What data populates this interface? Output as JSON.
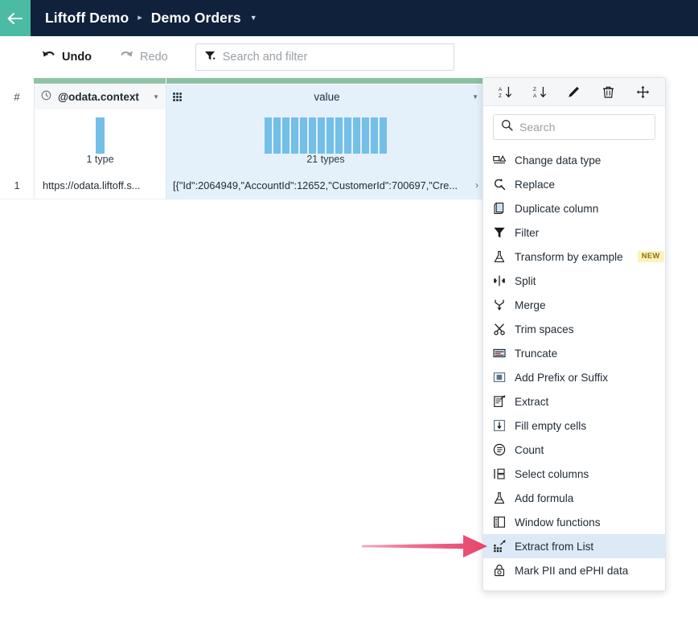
{
  "appbar": {
    "back_icon": "arrow-left-icon",
    "breadcrumb": {
      "root": "Liftoff Demo",
      "separator": "▸",
      "current": "Demo Orders",
      "caret": "▼"
    },
    "bg_color": "#10213c",
    "back_color": "#4cbba4"
  },
  "toolbar": {
    "undo_label": "Undo",
    "redo_label": "Redo",
    "search_placeholder": "Search and filter",
    "filter_icon": "filter-icon"
  },
  "grid": {
    "row_number_header": "#",
    "columns": [
      {
        "name": "@odata.context",
        "type_icon": "clock-icon",
        "caret": "▼",
        "types_label": "1 type",
        "histogram": [
          100
        ],
        "selected": false
      },
      {
        "name": "value",
        "drag_icon": "drag-dots-icon",
        "caret": "▼",
        "types_label": "21 types",
        "histogram": [
          100,
          100,
          100,
          100,
          100,
          100,
          100,
          100,
          100,
          100,
          100,
          100,
          100,
          100
        ],
        "selected": true
      }
    ],
    "rows": [
      {
        "number": "1",
        "context": "https://odata.liftoff.s...",
        "value": "[{\"Id\":2064949,\"AccountId\":12652,\"CustomerId\":700697,\"Cre...",
        "expand_icon": "chevron-right-icon"
      }
    ],
    "quality_bar_color": "#90c3a6",
    "selected_column_color": "#e4f1fb",
    "histogram_bar_color": "#73bfe8"
  },
  "context_menu": {
    "toolbar_icons": [
      {
        "name": "sort-ascending-icon",
        "label": "Sort ascending"
      },
      {
        "name": "sort-descending-icon",
        "label": "Sort descending"
      },
      {
        "name": "edit-pencil-icon",
        "label": "Rename"
      },
      {
        "name": "trash-delete-icon",
        "label": "Delete"
      },
      {
        "name": "move-icon",
        "label": "Move"
      }
    ],
    "search_placeholder": "Search",
    "search_icon": "search-icon",
    "items": [
      {
        "label": "Change data type",
        "icon": "change-data-type-icon",
        "badge": null,
        "active": false
      },
      {
        "label": "Replace",
        "icon": "replace-search-icon",
        "badge": null,
        "active": false
      },
      {
        "label": "Duplicate column",
        "icon": "duplicate-column-icon",
        "badge": null,
        "active": false
      },
      {
        "label": "Filter",
        "icon": "filter-icon",
        "badge": null,
        "active": false
      },
      {
        "label": "Transform by example",
        "icon": "flask-icon",
        "badge": "NEW",
        "active": false
      },
      {
        "label": "Split",
        "icon": "split-icon",
        "badge": null,
        "active": false
      },
      {
        "label": "Merge",
        "icon": "merge-icon",
        "badge": null,
        "active": false
      },
      {
        "label": "Trim spaces",
        "icon": "scissors-icon",
        "badge": null,
        "active": false
      },
      {
        "label": "Truncate",
        "icon": "truncate-icon",
        "badge": null,
        "active": false
      },
      {
        "label": "Add Prefix or Suffix",
        "icon": "prefix-suffix-icon",
        "badge": null,
        "active": false
      },
      {
        "label": "Extract",
        "icon": "extract-icon",
        "badge": null,
        "active": false
      },
      {
        "label": "Fill empty cells",
        "icon": "fill-empty-cells-icon",
        "badge": null,
        "active": false
      },
      {
        "label": "Count",
        "icon": "count-icon",
        "badge": null,
        "active": false
      },
      {
        "label": "Select columns",
        "icon": "select-columns-icon",
        "badge": null,
        "active": false
      },
      {
        "label": "Add formula",
        "icon": "flask-formula-icon",
        "badge": null,
        "active": false
      },
      {
        "label": "Window functions",
        "icon": "window-functions-icon",
        "badge": null,
        "active": false
      },
      {
        "label": "Extract from List",
        "icon": "extract-from-list-icon",
        "badge": null,
        "active": true
      },
      {
        "label": "Mark PII and ePHI data",
        "icon": "lock-pii-icon",
        "badge": null,
        "active": false
      }
    ],
    "badge_color": "#fdf3ba",
    "active_item_color": "#dbeaf6"
  },
  "annotation": {
    "arrow_icon": "pointer-arrow-icon",
    "arrow_color": "#e8476f",
    "points_to": "Extract from List"
  }
}
